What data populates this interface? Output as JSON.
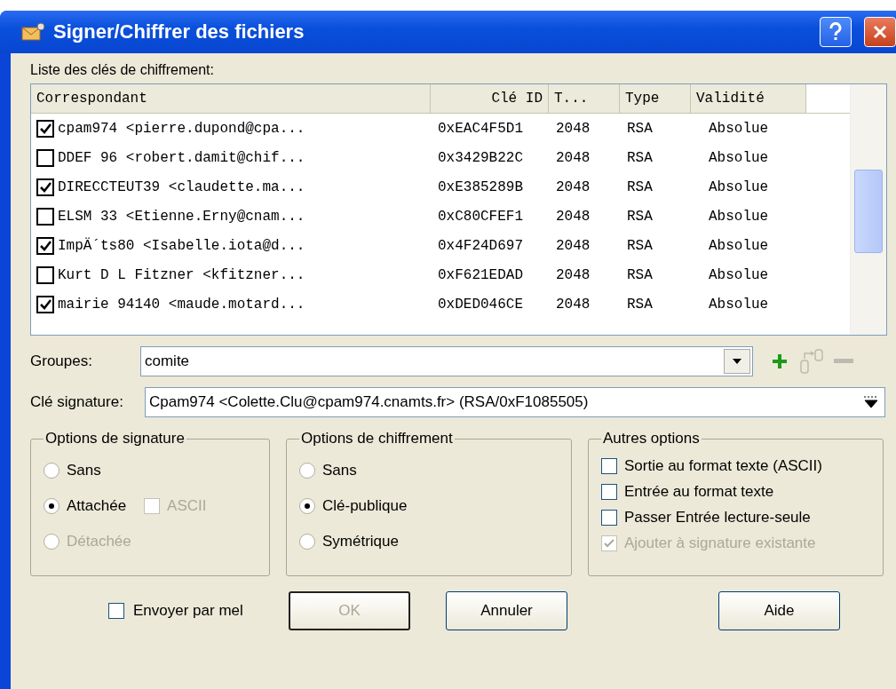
{
  "window": {
    "title": "Signer/Chiffrer des fichiers"
  },
  "key_list": {
    "label": "Liste des clés de chiffrement:",
    "columns": [
      "Correspondant",
      "Clé ID",
      "T...",
      "Type",
      "Validité"
    ],
    "rows": [
      {
        "checked": true,
        "correspondant": "cpam974 <pierre.dupond@cpa...",
        "key_id": "0xEAC4F5D1",
        "size": "2048",
        "type": "RSA",
        "validity": "Absolue"
      },
      {
        "checked": false,
        "correspondant": "DDEF 96 <robert.damit@chif...",
        "key_id": "0x3429B22C",
        "size": "2048",
        "type": "RSA",
        "validity": "Absolue"
      },
      {
        "checked": true,
        "correspondant": "DIRECCTEUT39 <claudette.ma...",
        "key_id": "0xE385289B",
        "size": "2048",
        "type": "RSA",
        "validity": "Absolue"
      },
      {
        "checked": false,
        "correspondant": "ELSM 33 <Etienne.Erny@cnam...",
        "key_id": "0xC80CFEF1",
        "size": "2048",
        "type": "RSA",
        "validity": "Absolue"
      },
      {
        "checked": true,
        "correspondant": "ImpÄ´ts80 <Isabelle.iota@d...",
        "key_id": "0x4F24D697",
        "size": "2048",
        "type": "RSA",
        "validity": "Absolue"
      },
      {
        "checked": false,
        "correspondant": "Kurt D L Fitzner <kfitzner...",
        "key_id": "0xF621EDAD",
        "size": "2048",
        "type": "RSA",
        "validity": "Absolue"
      },
      {
        "checked": true,
        "correspondant": "mairie 94140 <maude.motard...",
        "key_id": "0xDED046CE",
        "size": "2048",
        "type": "RSA",
        "validity": "Absolue"
      }
    ]
  },
  "groups": {
    "label": "Groupes:",
    "value": "comite",
    "tools": [
      {
        "kind": "add",
        "disabled": false
      },
      {
        "kind": "link",
        "disabled": true
      },
      {
        "kind": "remove",
        "disabled": true
      }
    ]
  },
  "signature_key": {
    "label": "Clé signature:",
    "value": "Cpam974 <Colette.Clu@cpam974.cnamts.fr> (RSA/0xF1085505)"
  },
  "signature_options": {
    "title": "Options de signature",
    "options": [
      {
        "label": "Sans",
        "selected": false,
        "disabled": false
      },
      {
        "label": "Attachée",
        "selected": true,
        "disabled": false,
        "extra": {
          "label": "ASCII",
          "checked": false,
          "disabled": true
        }
      },
      {
        "label": "Détachée",
        "selected": false,
        "disabled": true
      }
    ]
  },
  "encryption_options": {
    "title": "Options de chiffrement",
    "options": [
      {
        "label": "Sans",
        "selected": false,
        "disabled": false
      },
      {
        "label": "Clé-publique",
        "selected": true,
        "disabled": false
      },
      {
        "label": "Symétrique",
        "selected": false,
        "disabled": false
      }
    ]
  },
  "other_options": {
    "title": "Autres options",
    "options": [
      {
        "label": "Sortie au format texte (ASCII)",
        "checked": false,
        "disabled": false
      },
      {
        "label": "Entrée au format texte",
        "checked": false,
        "disabled": false
      },
      {
        "label": "Passer Entrée lecture-seule",
        "checked": false,
        "disabled": false
      },
      {
        "label": "Ajouter à signature existante",
        "checked": true,
        "disabled": true
      }
    ]
  },
  "send_by_mail": {
    "label": "Envoyer par mel",
    "checked": false
  },
  "buttons": [
    {
      "label": "OK",
      "disabled": true
    },
    {
      "label": "Annuler",
      "disabled": false
    },
    {
      "label": "Aide",
      "disabled": false
    }
  ]
}
